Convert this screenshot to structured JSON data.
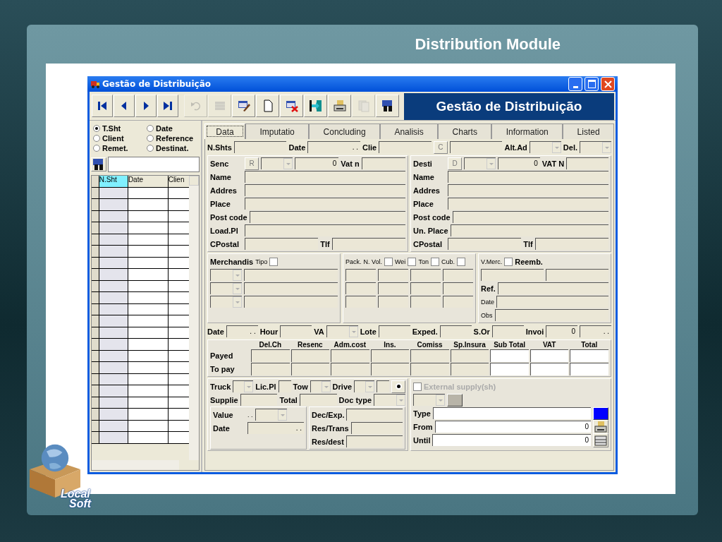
{
  "slide": {
    "title": "Distribution Module",
    "logo": [
      "Local",
      "Soft"
    ]
  },
  "window": {
    "title": "Gestão de Distribuição",
    "banner": "Gestão de Distribuição"
  },
  "toolbar": [
    {
      "kind": "first",
      "disabled": false
    },
    {
      "kind": "prev",
      "disabled": false
    },
    {
      "kind": "next",
      "disabled": false
    },
    {
      "kind": "last",
      "disabled": false
    },
    {
      "kind": "undo",
      "disabled": true
    },
    {
      "kind": "grid",
      "disabled": true
    },
    {
      "kind": "edit",
      "disabled": false
    },
    {
      "kind": "new",
      "disabled": false
    },
    {
      "kind": "delete",
      "disabled": false
    },
    {
      "kind": "exit",
      "disabled": false
    },
    {
      "kind": "print",
      "disabled": false
    },
    {
      "kind": "copy",
      "disabled": true
    },
    {
      "kind": "find",
      "disabled": false
    }
  ],
  "sort_options": [
    {
      "label": "T.Sht",
      "selected": true
    },
    {
      "label": "Date",
      "selected": false
    },
    {
      "label": "Client",
      "selected": false
    },
    {
      "label": "Reference",
      "selected": false
    },
    {
      "label": "Remet.",
      "selected": false
    },
    {
      "label": "Destinat.",
      "selected": false
    }
  ],
  "list": {
    "columns": [
      {
        "label": "N.Sht",
        "selected": true
      },
      {
        "label": "Date",
        "selected": false
      },
      {
        "label": "Clien",
        "selected": false
      }
    ]
  },
  "tabs": [
    {
      "label": "Data",
      "selected": true
    },
    {
      "label": "Imputatio",
      "selected": false
    },
    {
      "label": "Concluding",
      "selected": false
    },
    {
      "label": "Analisis",
      "selected": false
    },
    {
      "label": "Charts",
      "selected": false
    },
    {
      "label": "Information",
      "selected": false
    },
    {
      "label": "Listed",
      "selected": false
    }
  ],
  "form": [
    {
      "kind": "row",
      "items": [
        {
          "kind": "label",
          "text": "N.Shts"
        },
        {
          "kind": "field"
        },
        {
          "kind": "label",
          "text": "Date"
        },
        {
          "kind": "field",
          "value": ". ."
        },
        {
          "kind": "label",
          "text": "Clie"
        },
        {
          "kind": "field"
        },
        {
          "kind": "button",
          "text": "C",
          "disabled": true
        },
        {
          "kind": "field"
        },
        {
          "kind": "label",
          "text": "Alt.Ad"
        },
        {
          "kind": "combo",
          "disabled": true
        },
        {
          "kind": "label",
          "text": "Del."
        },
        {
          "kind": "combo",
          "disabled": true
        }
      ]
    },
    {
      "kind": "split",
      "children": [
        {
          "kind": "panel",
          "children": [
            {
              "kind": "row",
              "items": [
                {
                  "kind": "caption",
                  "text": "Senc"
                },
                {
                  "kind": "button",
                  "text": "R",
                  "disabled": true
                },
                {
                  "kind": "combo",
                  "disabled": true
                },
                {
                  "kind": "field",
                  "value": "0"
                },
                {
                  "kind": "label",
                  "text": "Vat n"
                },
                {
                  "kind": "field"
                }
              ]
            },
            {
              "kind": "row",
              "items": [
                {
                  "kind": "caption",
                  "text": "Name"
                },
                {
                  "kind": "field"
                }
              ]
            },
            {
              "kind": "row",
              "items": [
                {
                  "kind": "caption",
                  "text": "Addres"
                },
                {
                  "kind": "field"
                }
              ]
            },
            {
              "kind": "row",
              "items": [
                {
                  "kind": "caption",
                  "text": "Place"
                },
                {
                  "kind": "field"
                }
              ]
            },
            {
              "kind": "row",
              "items": [
                {
                  "kind": "caption",
                  "text": "Post code"
                },
                {
                  "kind": "field"
                }
              ]
            },
            {
              "kind": "row",
              "items": [
                {
                  "kind": "caption",
                  "text": "Load.Pl"
                },
                {
                  "kind": "field"
                }
              ]
            },
            {
              "kind": "row",
              "items": [
                {
                  "kind": "caption",
                  "text": "CPostal"
                },
                {
                  "kind": "field"
                },
                {
                  "kind": "label",
                  "text": "Tlf"
                },
                {
                  "kind": "field"
                }
              ]
            }
          ]
        },
        {
          "kind": "panel",
          "children": [
            {
              "kind": "row",
              "items": [
                {
                  "kind": "caption",
                  "text": "Desti"
                },
                {
                  "kind": "button",
                  "text": "D",
                  "disabled": true
                },
                {
                  "kind": "combo",
                  "disabled": true
                },
                {
                  "kind": "field",
                  "value": "0"
                },
                {
                  "kind": "label",
                  "text": "VAT N"
                },
                {
                  "kind": "field"
                }
              ]
            },
            {
              "kind": "row",
              "items": [
                {
                  "kind": "caption",
                  "text": "Name"
                },
                {
                  "kind": "field"
                }
              ]
            },
            {
              "kind": "row",
              "items": [
                {
                  "kind": "caption",
                  "text": "Addres"
                },
                {
                  "kind": "field"
                }
              ]
            },
            {
              "kind": "row",
              "items": [
                {
                  "kind": "caption",
                  "text": "Place"
                },
                {
                  "kind": "field"
                }
              ]
            },
            {
              "kind": "row",
              "items": [
                {
                  "kind": "caption",
                  "text": "Post code"
                },
                {
                  "kind": "field"
                }
              ]
            },
            {
              "kind": "row",
              "items": [
                {
                  "kind": "caption",
                  "text": "Un. Place"
                },
                {
                  "kind": "field"
                }
              ]
            },
            {
              "kind": "row",
              "items": [
                {
                  "kind": "caption",
                  "text": "CPostal"
                },
                {
                  "kind": "field"
                },
                {
                  "kind": "label",
                  "text": "Tlf"
                },
                {
                  "kind": "field"
                }
              ]
            }
          ]
        }
      ]
    },
    {
      "kind": "split",
      "children": [
        {
          "kind": "panel",
          "children": [
            {
              "kind": "row",
              "items": [
                {
                  "kind": "label",
                  "text": "Merchandis"
                },
                {
                  "kind": "small",
                  "text": "Tipo"
                },
                {
                  "kind": "check",
                  "checked": false
                }
              ]
            },
            {
              "kind": "row",
              "items": [
                {
                  "kind": "combo",
                  "disabled": true
                },
                {
                  "kind": "field"
                }
              ]
            },
            {
              "kind": "row",
              "items": [
                {
                  "kind": "combo",
                  "disabled": true
                },
                {
                  "kind": "field"
                }
              ]
            },
            {
              "kind": "row",
              "items": [
                {
                  "kind": "combo",
                  "disabled": true
                },
                {
                  "kind": "field"
                }
              ]
            }
          ]
        },
        {
          "kind": "panel",
          "children": [
            {
              "kind": "row",
              "items": [
                {
                  "kind": "small",
                  "text": "Pack."
                },
                {
                  "kind": "small",
                  "text": "N. Vol."
                },
                {
                  "kind": "check",
                  "checked": false
                },
                {
                  "kind": "small",
                  "text": "Wei"
                },
                {
                  "kind": "check",
                  "checked": false
                },
                {
                  "kind": "small",
                  "text": "Ton"
                },
                {
                  "kind": "check",
                  "checked": false
                },
                {
                  "kind": "small",
                  "text": "Cub."
                },
                {
                  "kind": "check",
                  "checked": false
                }
              ]
            },
            {
              "kind": "row",
              "items": [
                {
                  "kind": "field"
                },
                {
                  "kind": "field"
                },
                {
                  "kind": "field"
                },
                {
                  "kind": "field"
                }
              ]
            },
            {
              "kind": "row",
              "items": [
                {
                  "kind": "field"
                },
                {
                  "kind": "field"
                },
                {
                  "kind": "field"
                },
                {
                  "kind": "field"
                }
              ]
            },
            {
              "kind": "row",
              "items": [
                {
                  "kind": "field"
                },
                {
                  "kind": "field"
                },
                {
                  "kind": "field"
                },
                {
                  "kind": "field"
                }
              ]
            }
          ]
        },
        {
          "kind": "panel",
          "children": [
            {
              "kind": "row",
              "items": [
                {
                  "kind": "small",
                  "text": "V.Merc."
                },
                {
                  "kind": "check",
                  "checked": false
                },
                {
                  "kind": "label",
                  "text": "Reemb."
                }
              ]
            },
            {
              "kind": "row",
              "items": [
                {
                  "kind": "field"
                },
                {
                  "kind": "field"
                }
              ]
            },
            {
              "kind": "row",
              "items": [
                {
                  "kind": "label",
                  "text": "Ref."
                },
                {
                  "kind": "field"
                }
              ]
            },
            {
              "kind": "row",
              "items": [
                {
                  "kind": "small",
                  "text": "Date"
                },
                {
                  "kind": "field"
                }
              ]
            },
            {
              "kind": "row",
              "items": [
                {
                  "kind": "small",
                  "text": "Obs"
                },
                {
                  "kind": "field"
                }
              ]
            }
          ]
        }
      ]
    },
    {
      "kind": "row",
      "items": [
        {
          "kind": "label",
          "text": "Date"
        },
        {
          "kind": "field",
          "value": ". ."
        },
        {
          "kind": "label",
          "text": "Hour"
        },
        {
          "kind": "field"
        },
        {
          "kind": "label",
          "text": "VA"
        },
        {
          "kind": "combo",
          "disabled": true
        },
        {
          "kind": "label",
          "text": "Lote"
        },
        {
          "kind": "field"
        },
        {
          "kind": "label",
          "text": "Exped."
        },
        {
          "kind": "field"
        },
        {
          "kind": "label",
          "text": "S.Or"
        },
        {
          "kind": "field"
        },
        {
          "kind": "label",
          "text": "Invoi"
        },
        {
          "kind": "field",
          "value": "0"
        },
        {
          "kind": "field",
          "value": ". ."
        }
      ]
    },
    {
      "kind": "table",
      "columns": [
        {
          "label": "Del.Ch",
          "kind": "cost"
        },
        {
          "label": "Resenc",
          "kind": "cost"
        },
        {
          "label": "Adm.cost",
          "kind": "cost"
        },
        {
          "label": "Ins.",
          "kind": "cost"
        },
        {
          "label": "Comiss",
          "kind": "cost"
        },
        {
          "label": "Sp.Insura",
          "kind": "cost"
        },
        {
          "label": "Sub Total",
          "kind": "total"
        },
        {
          "label": "VAT",
          "kind": "total"
        },
        {
          "label": "Total",
          "kind": "total"
        }
      ],
      "rows": [
        "Payed",
        "To pay"
      ]
    },
    {
      "kind": "split",
      "children": [
        {
          "kind": "panel",
          "children": [
            {
              "kind": "row",
              "items": [
                {
                  "kind": "label",
                  "text": "Truck"
                },
                {
                  "kind": "combo",
                  "disabled": true
                },
                {
                  "kind": "label",
                  "text": "Lic.Pl"
                },
                {
                  "kind": "field"
                },
                {
                  "kind": "label",
                  "text": "Tow"
                },
                {
                  "kind": "combo",
                  "disabled": true
                },
                {
                  "kind": "label",
                  "text": "Drive"
                },
                {
                  "kind": "combo",
                  "disabled": true
                },
                {
                  "kind": "field"
                },
                {
                  "kind": "radio"
                }
              ]
            },
            {
              "kind": "row",
              "items": [
                {
                  "kind": "label",
                  "text": "Supplie"
                },
                {
                  "kind": "field"
                },
                {
                  "kind": "label",
                  "text": "Total"
                },
                {
                  "kind": "field"
                },
                {
                  "kind": "label",
                  "text": "Doc type"
                },
                {
                  "kind": "combo",
                  "disabled": true
                }
              ]
            },
            {
              "kind": "split",
              "children": [
                {
                  "kind": "panel",
                  "children": [
                    {
                      "kind": "row",
                      "items": [
                        {
                          "kind": "caption",
                          "text": "Value"
                        },
                        {
                          "kind": "small",
                          "text": ". ."
                        },
                        {
                          "kind": "combo",
                          "disabled": true
                        }
                      ]
                    },
                    {
                      "kind": "row",
                      "items": [
                        {
                          "kind": "caption",
                          "text": "Date"
                        },
                        {
                          "kind": "field",
                          "value": ". ."
                        }
                      ]
                    }
                  ]
                },
                {
                  "kind": "panel",
                  "children": [
                    {
                      "kind": "row",
                      "items": [
                        {
                          "kind": "caption",
                          "text": "Dec/Exp."
                        },
                        {
                          "kind": "field"
                        }
                      ]
                    },
                    {
                      "kind": "row",
                      "items": [
                        {
                          "kind": "caption",
                          "text": "Res/Trans"
                        },
                        {
                          "kind": "field"
                        }
                      ]
                    },
                    {
                      "kind": "row",
                      "items": [
                        {
                          "kind": "caption",
                          "text": "Res/dest"
                        },
                        {
                          "kind": "field"
                        }
                      ]
                    }
                  ]
                }
              ]
            }
          ]
        },
        {
          "kind": "panel",
          "children": [
            {
              "kind": "row",
              "items": [
                {
                  "kind": "check",
                  "text": "External supply(sh)",
                  "checked": false,
                  "disabled": true
                }
              ]
            },
            {
              "kind": "row",
              "items": [
                {
                  "kind": "combo",
                  "disabled": true
                },
                {
                  "kind": "swatch",
                  "color": "#b8b4a8"
                }
              ]
            },
            {
              "kind": "row",
              "items": [
                {
                  "kind": "label",
                  "text": "Type"
                },
                {
                  "kind": "white"
                },
                {
                  "kind": "swatch",
                  "color": "#0000ff"
                }
              ]
            },
            {
              "kind": "row",
              "items": [
                {
                  "kind": "label",
                  "text": "From"
                },
                {
                  "kind": "white",
                  "value": "0"
                },
                {
                  "kind": "printer"
                }
              ]
            },
            {
              "kind": "row",
              "items": [
                {
                  "kind": "label",
                  "text": "Until"
                },
                {
                  "kind": "white",
                  "value": "0"
                },
                {
                  "kind": "tape"
                }
              ]
            }
          ]
        }
      ]
    }
  ]
}
